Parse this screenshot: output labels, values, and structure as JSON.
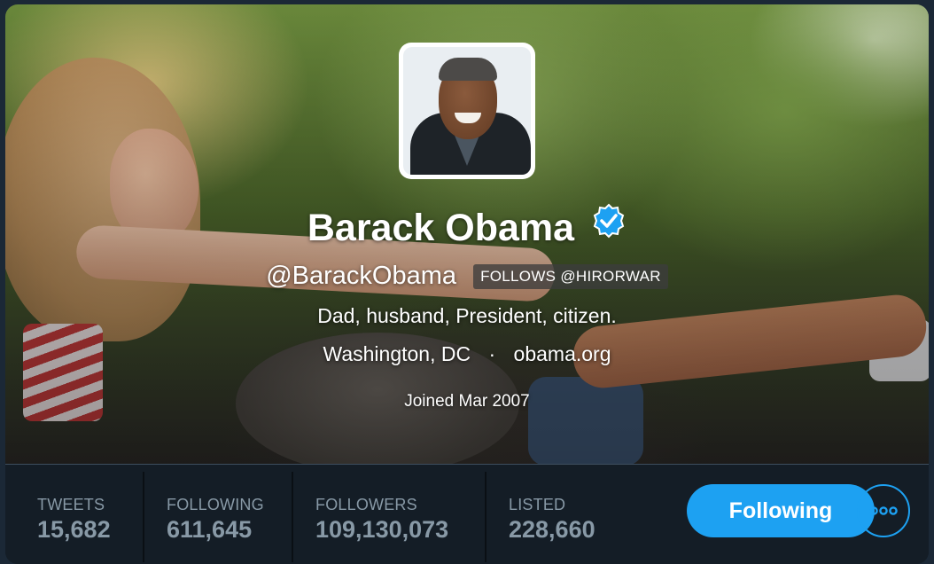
{
  "profile": {
    "name": "Barack Obama",
    "handle": "@BarackObama",
    "follows_badge": "FOLLOWS @HIRORWAR",
    "bio": "Dad, husband, President, citizen.",
    "location": "Washington, DC",
    "separator": "·",
    "website": "obama.org",
    "joined": "Joined Mar 2007",
    "verified": true
  },
  "stats": [
    {
      "label": "TWEETS",
      "value": "15,682"
    },
    {
      "label": "FOLLOWING",
      "value": "611,645"
    },
    {
      "label": "FOLLOWERS",
      "value": "109,130,073"
    },
    {
      "label": "LISTED",
      "value": "228,660"
    }
  ],
  "actions": {
    "follow_label": "Following",
    "more_icon": "ellipsis-icon"
  },
  "colors": {
    "accent": "#1da1f2",
    "stats_bg": "#141d26",
    "stats_text": "#8899a6"
  }
}
